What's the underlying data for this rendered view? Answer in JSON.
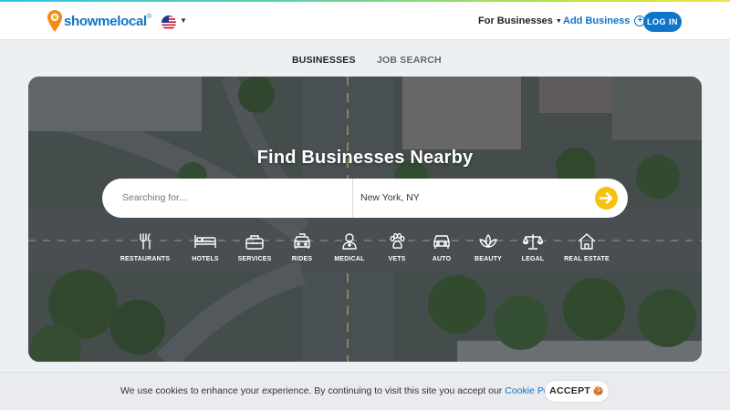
{
  "header": {
    "logo_text": "showmelocal",
    "logo_mark": "®",
    "for_businesses": "For Businesses",
    "add_business": "Add Business",
    "login": "LOG IN"
  },
  "tabs": [
    {
      "label": "BUSINESSES",
      "active": true
    },
    {
      "label": "JOB SEARCH",
      "active": false
    }
  ],
  "hero": {
    "title": "Find Businesses Nearby",
    "search_placeholder": "Searching for...",
    "location": "New York, NY"
  },
  "categories": [
    {
      "label": "RESTAURANTS",
      "icon": "fork-knife-icon"
    },
    {
      "label": "HOTELS",
      "icon": "bed-icon"
    },
    {
      "label": "SERVICES",
      "icon": "toolbox-icon"
    },
    {
      "label": "RIDES",
      "icon": "taxi-icon"
    },
    {
      "label": "MEDICAL",
      "icon": "doctor-icon"
    },
    {
      "label": "VETS",
      "icon": "paw-icon"
    },
    {
      "label": "AUTO",
      "icon": "car-icon"
    },
    {
      "label": "BEAUTY",
      "icon": "lotus-icon"
    },
    {
      "label": "LEGAL",
      "icon": "scales-icon"
    },
    {
      "label": "REAL ESTATE",
      "icon": "house-icon"
    }
  ],
  "cookie": {
    "text": "We use cookies to enhance your experience. By continuing to visit this site you accept our",
    "link": "Cookie Policy",
    "accept": "ACCEPT",
    "accept_emoji": "🍪"
  },
  "colors": {
    "brand_blue": "#0e75c8",
    "go_yellow": "#f5c20e",
    "accent_gradient": [
      "#33c3ea",
      "#b3e24a",
      "#f0e34a"
    ]
  }
}
